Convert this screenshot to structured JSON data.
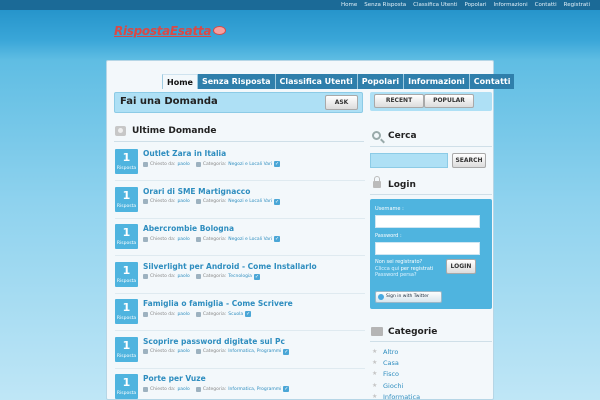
{
  "topnav": [
    "Home",
    "Senza Risposta",
    "Classifica Utenti",
    "Popolari",
    "Informazioni",
    "Contatti",
    "Registrati"
  ],
  "logo": "RispostaEsatta",
  "mainnav": [
    {
      "label": "Home",
      "active": true
    },
    {
      "label": "Senza Risposta",
      "active": false
    },
    {
      "label": "Classifica Utenti",
      "active": false
    },
    {
      "label": "Popolari",
      "active": false
    },
    {
      "label": "Informazioni",
      "active": false
    },
    {
      "label": "Contatti",
      "active": false
    }
  ],
  "ask": {
    "title": "Fai una Domanda",
    "button": "ASK"
  },
  "sort": {
    "recent": "RECENT",
    "popular": "POPULAR"
  },
  "latest": {
    "title": "Ultime Domande",
    "meta_author_prefix": "Chiesto da:",
    "meta_category_prefix": "Categoria:",
    "questions": [
      {
        "count": "1",
        "count_label": "Risposta",
        "title": "Outlet Zara in Italia",
        "author": "paolo",
        "category": "Negozi e Locali Vari"
      },
      {
        "count": "1",
        "count_label": "Risposta",
        "title": "Orari di SME Martignacco",
        "author": "paolo",
        "category": "Negozi e Locali Vari"
      },
      {
        "count": "1",
        "count_label": "Risposta",
        "title": "Abercrombie Bologna",
        "author": "paolo",
        "category": "Negozi e Locali Vari"
      },
      {
        "count": "1",
        "count_label": "Risposta",
        "title": "Silverlight per Android - Come Installarlo",
        "author": "paolo",
        "category": "Tecnologia"
      },
      {
        "count": "1",
        "count_label": "Risposta",
        "title": "Famiglia o famiglia - Come Scrivere",
        "author": "paolo",
        "category": "Scuola"
      },
      {
        "count": "1",
        "count_label": "Risposta",
        "title": "Scoprire password digitate sul Pc",
        "author": "paolo",
        "category": "Informatica, Programmi"
      },
      {
        "count": "1",
        "count_label": "Risposta",
        "title": "Porte per Vuze",
        "author": "paolo",
        "category": "Informatica, Programmi"
      }
    ]
  },
  "search": {
    "title": "Cerca",
    "button": "SEARCH"
  },
  "login": {
    "title": "Login",
    "username_label": "Username :",
    "password_label": "Password :",
    "not_registered": "Non sei registrato?",
    "click_here": "Clicca qui",
    "to_register": "per registrati",
    "forgot": "Password persa?",
    "button": "LOGIN",
    "twitter": "Sign in with Twitter"
  },
  "categories": {
    "title": "Categorie",
    "items": [
      "Altro",
      "Casa",
      "Fisco",
      "Giochi",
      "Informatica"
    ]
  },
  "colors": {
    "accent": "#4fb4df",
    "nav": "#2f7fab",
    "link": "#2e8dbf",
    "logo": "#d94a46"
  }
}
